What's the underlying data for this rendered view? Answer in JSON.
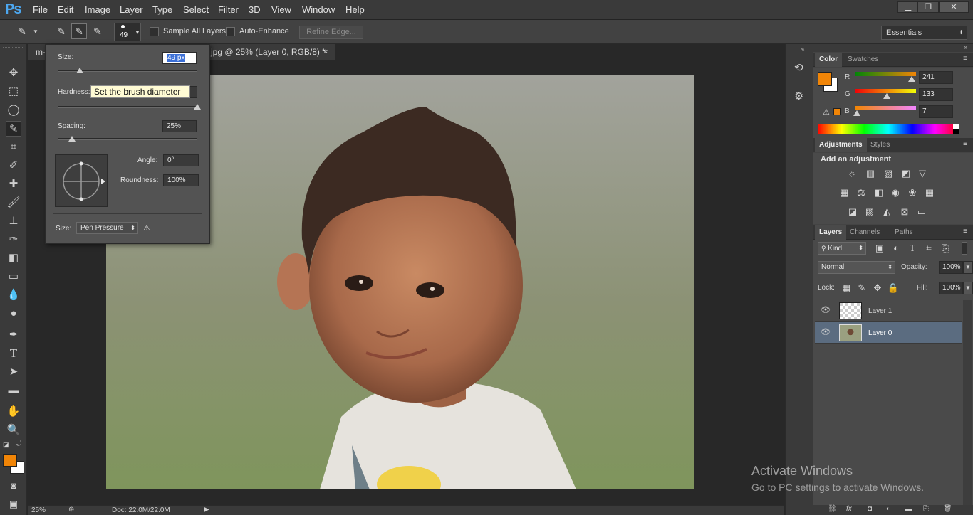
{
  "app": {
    "logo": "Ps"
  },
  "menu": [
    "File",
    "Edit",
    "Image",
    "Layer",
    "Type",
    "Select",
    "Filter",
    "3D",
    "View",
    "Window",
    "Help"
  ],
  "window_controls": {
    "minimize": "▁",
    "restore": "❐",
    "close": "✕"
  },
  "options_bar": {
    "brush_size": "49",
    "sample_all_layers": "Sample All Layers",
    "auto_enhance": "Auto-Enhance",
    "refine_edge": "Refine Edge...",
    "workspace": "Essentials"
  },
  "document": {
    "tab_prefix": "m-",
    "tab_title": "jpg @ 25% (Layer 0, RGB/8) *",
    "zoom": "25%",
    "doc_info": "Doc: 22.0M/22.0M"
  },
  "brush_popup": {
    "size_label": "Size:",
    "size_value": "49 px",
    "size_level": 0.16,
    "hardness_label": "Hardness:",
    "hardness_level": 1.0,
    "spacing_label": "Spacing:",
    "spacing_value": "25%",
    "spacing_level": 0.1,
    "angle_label": "Angle:",
    "angle_value": "0°",
    "roundness_label": "Roundness:",
    "roundness_value": "100%",
    "size_control_label": "Size:",
    "size_control_value": "Pen Pressure"
  },
  "tooltip": "Set the brush diameter",
  "color_panel": {
    "tabs": [
      "Color",
      "Swatches"
    ],
    "foreground": "#f18507",
    "background": "#ffffff",
    "r_label": "R",
    "r_value": "241",
    "g_label": "G",
    "g_value": "133",
    "b_label": "B",
    "b_value": "7"
  },
  "adjustments_panel": {
    "tabs": [
      "Adjustments",
      "Styles"
    ],
    "heading": "Add an adjustment"
  },
  "layers_panel": {
    "tabs": [
      "Layers",
      "Channels",
      "Paths"
    ],
    "filter": "Kind",
    "blend_mode": "Normal",
    "opacity_label": "Opacity:",
    "opacity": "100%",
    "lock_label": "Lock:",
    "fill_label": "Fill:",
    "fill": "100%",
    "layers": [
      {
        "name": "Layer 1",
        "selected": false
      },
      {
        "name": "Layer 0",
        "selected": true
      }
    ]
  },
  "watermark": {
    "line1": "Activate Windows",
    "line2": "Go to PC settings to activate Windows."
  }
}
